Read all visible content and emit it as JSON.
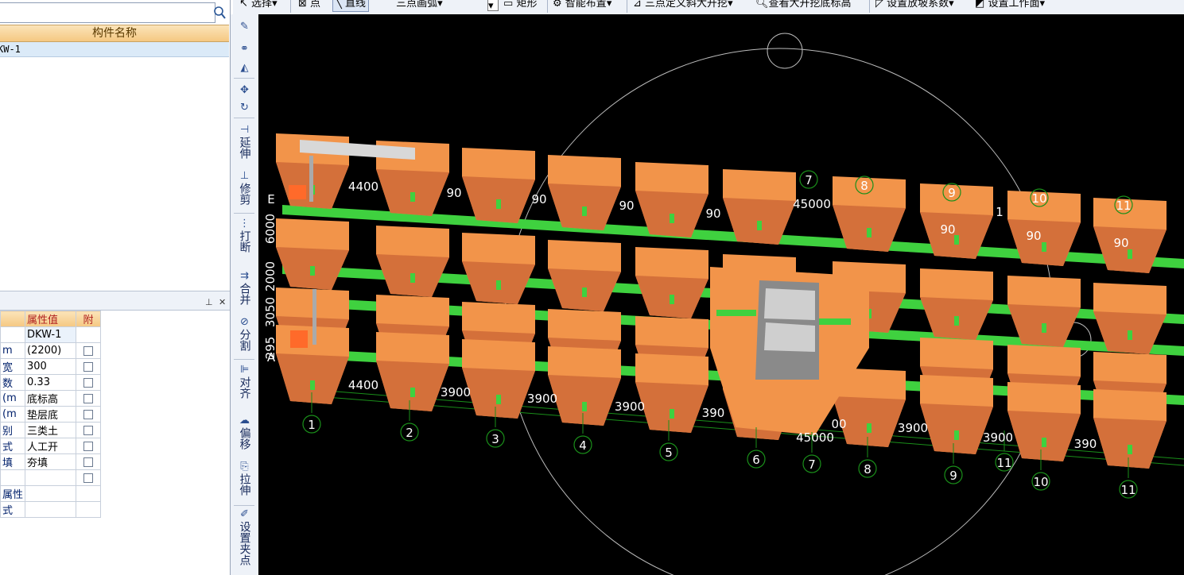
{
  "toolbar": {
    "items": [
      {
        "label": "选择",
        "icon": "cursor-icon"
      },
      {
        "label": "点",
        "icon": "point-icon"
      },
      {
        "label": "直线",
        "icon": "line-icon"
      },
      {
        "label": "三点画弧",
        "icon": "arc-icon"
      },
      {
        "label": "矩形",
        "icon": "rectangle-icon"
      },
      {
        "label": "智能布置",
        "icon": "smart-layout-icon"
      },
      {
        "label": "三点定义斜大开挖",
        "icon": "slope-excavation-icon"
      },
      {
        "label": "查看大开挖底标高",
        "icon": "view-elevation-icon"
      },
      {
        "label": "设置放坡系数",
        "icon": "slope-coefficient-icon"
      },
      {
        "label": "设置工作面",
        "icon": "work-face-icon"
      }
    ]
  },
  "component_list": {
    "search_placeholder": "",
    "header": "构件名称",
    "items": [
      "KW-1"
    ]
  },
  "properties": {
    "headers": {
      "name": "",
      "value": "属性值",
      "attach": "附"
    },
    "rows": [
      {
        "name": "",
        "value": "DKW-1",
        "checkbox": false
      },
      {
        "name": "m",
        "value": "(2200)",
        "checkbox": true
      },
      {
        "name": "宽",
        "value": "300",
        "checkbox": true
      },
      {
        "name": "数",
        "value": "0.33",
        "checkbox": true
      },
      {
        "name": "(m",
        "value": "底标高",
        "checkbox": true
      },
      {
        "name": "(m",
        "value": "垫层底",
        "checkbox": true
      },
      {
        "name": "别",
        "value": "三类土",
        "checkbox": true
      },
      {
        "name": "式",
        "value": "人工开",
        "checkbox": true
      },
      {
        "name": "填",
        "value": "夯填",
        "checkbox": true
      },
      {
        "name": "",
        "value": "",
        "checkbox": true
      },
      {
        "name": "属性",
        "value": "",
        "checkbox": false
      },
      {
        "name": "式",
        "value": "",
        "checkbox": false
      }
    ]
  },
  "side_tools": [
    {
      "label": "",
      "icon": "brush-icon"
    },
    {
      "label": "",
      "icon": "copy-icon"
    },
    {
      "label": "",
      "icon": "mirror-icon"
    },
    {
      "label": "",
      "icon": "move-icon"
    },
    {
      "label": "",
      "icon": "rotate-icon"
    },
    {
      "label": "延伸",
      "icon": "extend-icon"
    },
    {
      "label": "修剪",
      "icon": "trim-icon"
    },
    {
      "label": "打断",
      "icon": "break-icon"
    },
    {
      "label": "合并",
      "icon": "merge-icon"
    },
    {
      "label": "分割",
      "icon": "split-icon"
    },
    {
      "label": "对齐",
      "icon": "align-icon"
    },
    {
      "label": "偏移",
      "icon": "offset-icon"
    },
    {
      "label": "拉伸",
      "icon": "stretch-icon"
    },
    {
      "label": "设置夹点",
      "icon": "grip-icon"
    }
  ],
  "viewport": {
    "axis_numbers_near": [
      "1",
      "2",
      "3",
      "4",
      "5",
      "6",
      "7",
      "8",
      "9",
      "11",
      "10",
      "11"
    ],
    "axis_numbers_far": [
      "7",
      "8",
      "9",
      "10",
      "11"
    ],
    "dimensions_near": [
      "4400",
      "3900",
      "3900",
      "3900",
      "390",
      "00",
      "3900",
      "3900",
      "390",
      "45000"
    ],
    "dimensions_far": [
      "4400",
      "90",
      "90",
      "90",
      "90",
      "45000",
      "90",
      "90",
      "90",
      "1"
    ],
    "left_dims": [
      "6000",
      "2000",
      "3050",
      "295"
    ],
    "left_letters": [
      "E",
      "A"
    ],
    "colors": {
      "foundation": "#f2944a",
      "foundation_dark": "#d4703a",
      "beam": "#3fd13f",
      "grid": "#1a8f1a",
      "background": "#000000"
    }
  }
}
